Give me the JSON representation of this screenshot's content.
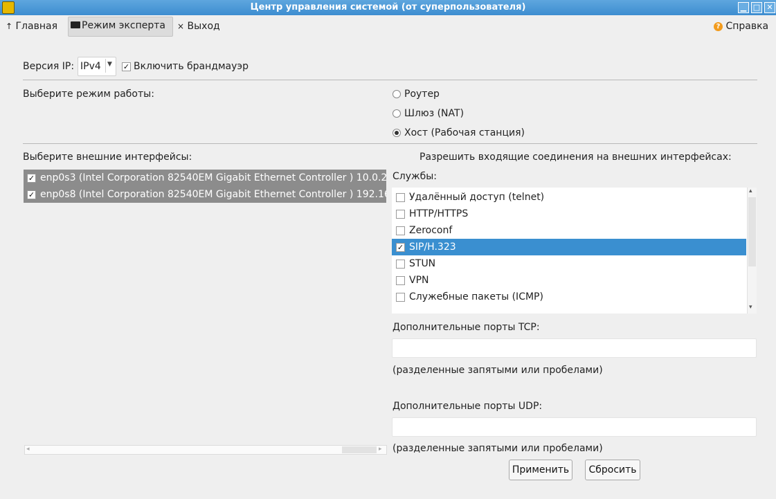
{
  "window": {
    "title": "Центр управления системой (от суперпользователя)",
    "controls": [
      "▁",
      "□",
      "✕"
    ]
  },
  "toolbar": {
    "home_label": "Главная",
    "home_icon": "↑",
    "expert_label": "Режим эксперта",
    "exit_label": "Выход",
    "exit_icon": "×",
    "help_label": "Справка",
    "help_icon": "?"
  },
  "ip": {
    "label": "Версия IP:",
    "value": "IPv4",
    "firewall_label": "Включить брандмауэр",
    "firewall_checked": true
  },
  "mode": {
    "label": "Выберите режим работы:",
    "options": [
      {
        "label": "Роутер",
        "selected": false
      },
      {
        "label": "Шлюз (NAT)",
        "selected": false
      },
      {
        "label": "Хост (Рабочая станция)",
        "selected": true
      }
    ]
  },
  "interfaces": {
    "label": "Выберите внешние интерфейсы:",
    "items": [
      {
        "label": "enp0s3 (Intel Corporation 82540EM Gigabit Ethernet Controller ) 10.0.2.",
        "checked": true
      },
      {
        "label": "enp0s8 (Intel Corporation 82540EM Gigabit Ethernet Controller ) 192.16",
        "checked": true
      }
    ]
  },
  "incoming": {
    "label": "Разрешить входящие соединения на внешних интерфейсах:",
    "services_label": "Службы:",
    "services": [
      {
        "label": "Удалённый доступ (telnet)",
        "checked": false
      },
      {
        "label": "HTTP/HTTPS",
        "checked": false
      },
      {
        "label": "Zeroconf",
        "checked": false
      },
      {
        "label": "SIP/H.323",
        "checked": true,
        "selected": true
      },
      {
        "label": "STUN",
        "checked": false
      },
      {
        "label": "VPN",
        "checked": false
      },
      {
        "label": "Служебные пакеты (ICMP)",
        "checked": false
      }
    ]
  },
  "tcp": {
    "label": "Дополнительные порты TCP:",
    "value": "",
    "hint": "(разделенные запятыми или пробелами)"
  },
  "udp": {
    "label": "Дополнительные порты UDP:",
    "value": "",
    "hint": "(разделенные запятыми или пробелами)"
  },
  "actions": {
    "apply_label": "Применить",
    "reset_label": "Сбросить"
  },
  "colors": {
    "selection": "#3a8fd0",
    "interface_bg": "#8c8c8c",
    "help_icon": "#f29b1d"
  }
}
